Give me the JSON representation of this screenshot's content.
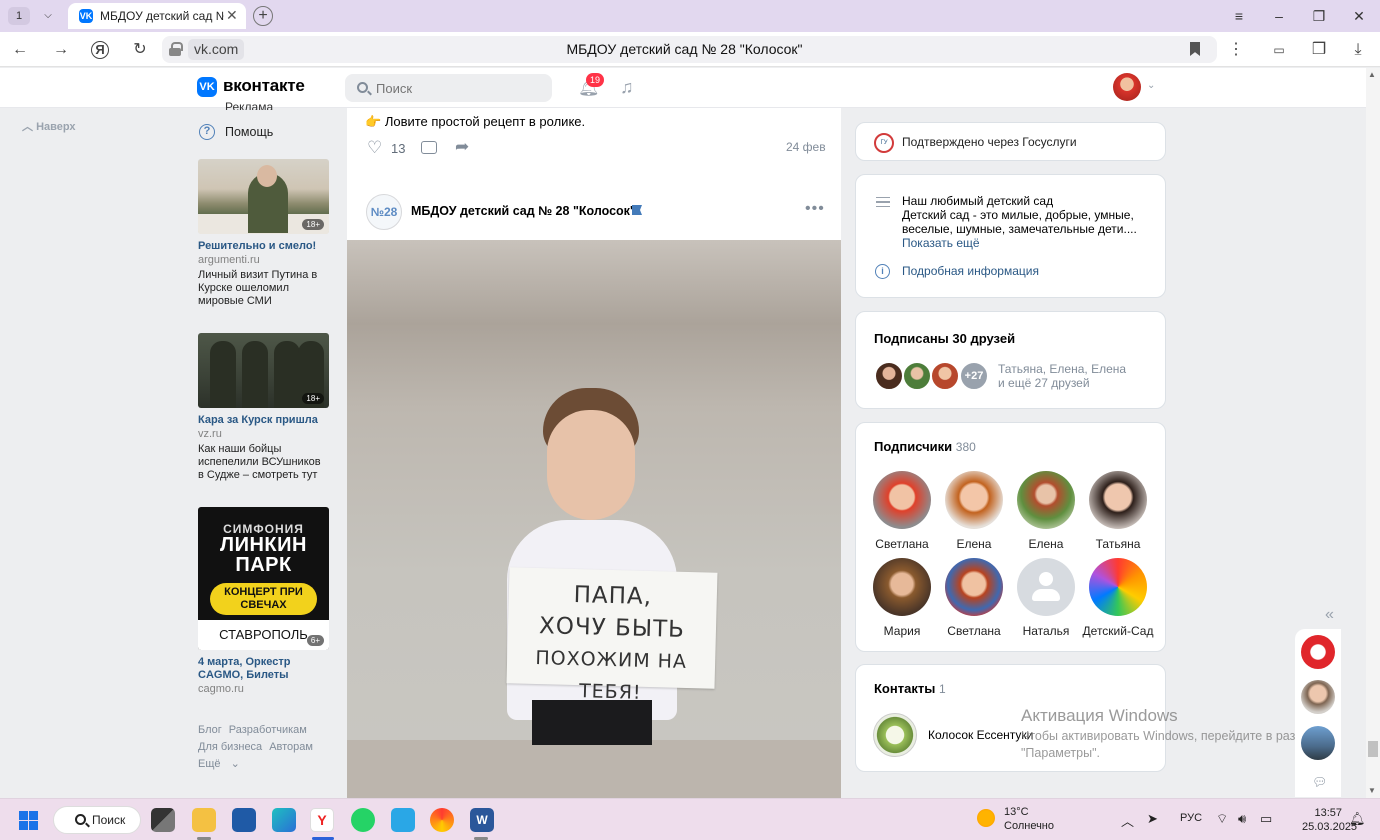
{
  "browser": {
    "tab_count": "1",
    "tab_title": "МБДОУ детский сад №",
    "domain": "vk.com",
    "page_title": "МБДОУ детский сад № 28 \"Колосок\""
  },
  "vk": {
    "brand": "вконтакте",
    "logo_text": "VK",
    "search_placeholder": "Поиск",
    "notifications_badge": "19"
  },
  "left": {
    "up_link": "Наверх",
    "ads_label": "Реклама",
    "help_label": "Помощь",
    "ads": [
      {
        "title": "Решительно и смело!",
        "domain": "argumenti.ru",
        "text": "Личный визит Путина в Курске ошеломил мировые СМИ",
        "age": "18+"
      },
      {
        "title": "Кара за Курск пришла",
        "domain": "vz.ru",
        "text": "Как наши бойцы испепелили ВСУшников в Судже – смотреть тут",
        "age": "18+"
      },
      {
        "title": "4 марта, Оркестр CAGMO, Билеты",
        "domain": "cagmo.ru",
        "text": "",
        "age": "6+",
        "banner_top": "СИМФОНИЯ",
        "banner_main": "ЛИНКИН ПАРК",
        "banner_pill": "КОНЦЕРТ ПРИ СВЕЧАХ",
        "banner_city": "СТАВРОПОЛЬ"
      }
    ],
    "footer": [
      "Блог",
      "Разработчикам",
      "Для бизнеса",
      "Авторам",
      "Ещё"
    ]
  },
  "feed": {
    "prev_post_text": "Ловите простой рецепт в ролике.",
    "prev_post_emoji": "👉",
    "likes": "13",
    "date": "24 фев",
    "group_name": "МБДОУ детский сад № 28 \"Колосок\"",
    "group_avatar_text": "№28",
    "sign_text": [
      "ПАПА,",
      "ХОЧУ БЫТЬ",
      "ПОХОЖИМ НА ТЕБЯ!"
    ]
  },
  "right": {
    "gosuslugi": "Подтверждено через Госуслуги",
    "about_title": "Наш любимый детский сад",
    "about_desc": "Детский сад - это милые, добрые, умные, веселые, шумные, замечательные дети....",
    "show_more": "Показать ещё",
    "details": "Подробная информация",
    "friends_title": "Подписаны 30 друзей",
    "friends_more": "+27",
    "friends_names": "Татьяна, Елена, Елена",
    "friends_rest": "и ещё 27 друзей",
    "subscribers_title": "Подписчики",
    "subscribers_count": "380",
    "subscribers": [
      "Светлана",
      "Елена",
      "Елена",
      "Татьяна",
      "Мария",
      "Светлана",
      "Наталья",
      "Детский-Сад"
    ],
    "contacts_title": "Контакты",
    "contacts_count": "1",
    "contact_name": "Колосок Ессентуки"
  },
  "watermark": {
    "title": "Активация Windows",
    "text": "Чтобы активировать Windows, перейдите в раздел \"Параметры\"."
  },
  "taskbar": {
    "search_label": "Поиск",
    "temp": "13°C",
    "weather": "Солнечно",
    "lang": "РУС",
    "time": "13:57",
    "date": "25.03.2025"
  },
  "colors": {
    "vk_blue": "#0077ff",
    "link": "#2a5885",
    "badge": "#ff3347"
  }
}
